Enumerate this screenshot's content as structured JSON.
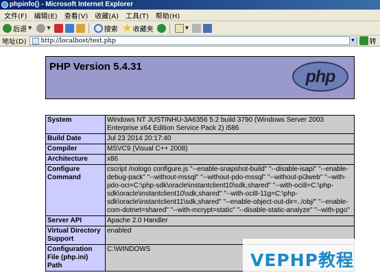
{
  "window": {
    "title": "phpinfo() - Microsoft Internet Explorer"
  },
  "menu": [
    "文件(F)",
    "编辑(E)",
    "查看(V)",
    "收藏(A)",
    "工具(T)",
    "帮助(H)"
  ],
  "toolbar": {
    "back_label": "后退",
    "search_label": "搜索",
    "favorites_label": "收藏夹"
  },
  "address": {
    "label": "地址(D)",
    "url": "http://localhost/test.php",
    "go_label": "转"
  },
  "page": {
    "header_title": "PHP Version 5.4.31",
    "logo_text": "php",
    "rows": [
      {
        "key": "System",
        "value": "Windows NT JUSTINHU-3A6356 5.2 build 3790 (Windows Server 2003 Enterprise x64 Edition Service Pack 2) i586"
      },
      {
        "key": "Build Date",
        "value": "Jul 23 2014 20:17:40"
      },
      {
        "key": "Compiler",
        "value": "MSVC9 (Visual C++ 2008)"
      },
      {
        "key": "Architecture",
        "value": "x86"
      },
      {
        "key": "Configure Command",
        "value": "cscript /nologo configure.js \"--enable-snapshot-build\" \"--disable-isapi\" \"--enable-debug-pack\" \"--without-mssql\" \"--without-pdo-mssql\" \"--without-pi3web\" \"--with-pdo-oci=C:\\php-sdk\\oracle\\instantclient10\\sdk,shared\" \"--with-oci8=C:\\php-sdk\\oracle\\instantclient10\\sdk,shared\" \"--with-oci8-11g=C:\\php-sdk\\oracle\\instantclient11\\sdk,shared\" \"--enable-object-out-dir=../obj/\" \"--enable-com-dotnet=shared\" \"--with-mcrypt=static\" \"--disable-static-analyze\" \"--with-pgo\""
      },
      {
        "key": "Server API",
        "value": "Apache 2.0 Handler"
      },
      {
        "key": "Virtual Directory Support",
        "value": "enabled"
      },
      {
        "key": "Configuration File (php.ini) Path",
        "value": "C:\\WINDOWS"
      }
    ]
  },
  "watermark": {
    "text": "VEPHP教程"
  }
}
